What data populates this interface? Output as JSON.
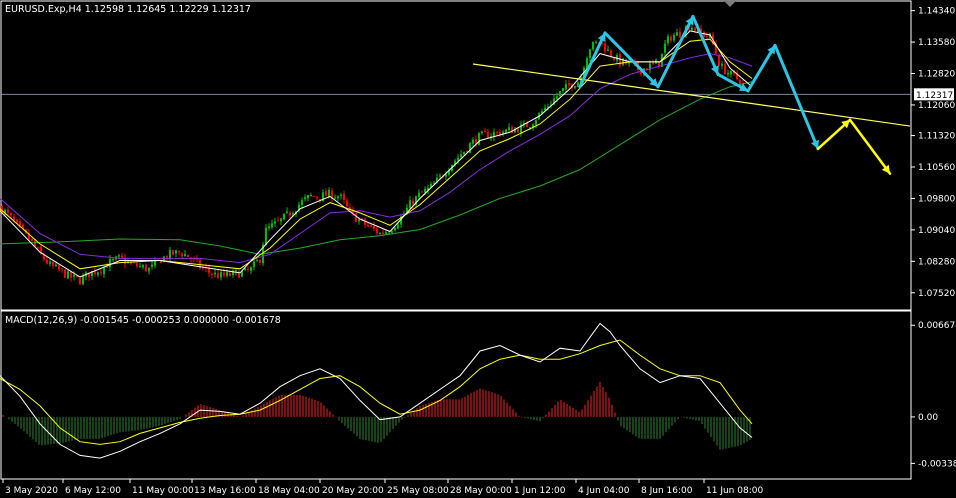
{
  "chart_data": [
    {
      "type": "candlestick",
      "title": "EURUSD.Exp,H4  1.12598 1.12645 1.12229 1.12317",
      "symbol": "EURUSD.Exp,H4",
      "ohlc_header": "1.12598 1.12645 1.12229 1.12317",
      "ylim": [
        1.072,
        1.145
      ],
      "y_ticks": [
        "1.14340",
        "1.13580",
        "1.12820",
        "1.12060",
        "1.11320",
        "1.10560",
        "1.09800",
        "1.09040",
        "1.08280",
        "1.07520"
      ],
      "current_price": "1.12317",
      "x_ticks": [
        "3 May 2020",
        "6 May 12:00",
        "11 May 00:00",
        "13 May 16:00",
        "18 May 04:00",
        "20 May 20:00",
        "25 May 08:00",
        "28 May 00:00",
        "1 Jun 12:00",
        "4 Jun 04:00",
        "8 Jun 16:00",
        "11 Jun 08:00"
      ],
      "price_path": [
        [
          0,
          1.096
        ],
        [
          10,
          1.0935
        ],
        [
          20,
          1.0905
        ],
        [
          30,
          1.088
        ],
        [
          40,
          1.0845
        ],
        [
          50,
          1.0818
        ],
        [
          60,
          1.0805
        ],
        [
          70,
          1.079
        ],
        [
          80,
          1.0782
        ],
        [
          90,
          1.08
        ],
        [
          100,
          1.0808
        ],
        [
          110,
          1.0825
        ],
        [
          120,
          1.0835
        ],
        [
          130,
          1.0822
        ],
        [
          140,
          1.0815
        ],
        [
          150,
          1.0808
        ],
        [
          160,
          1.0832
        ],
        [
          170,
          1.0845
        ],
        [
          180,
          1.085
        ],
        [
          190,
          1.0838
        ],
        [
          200,
          1.0815
        ],
        [
          210,
          1.08
        ],
        [
          220,
          1.0792
        ],
        [
          230,
          1.0795
        ],
        [
          240,
          1.08
        ],
        [
          250,
          1.0805
        ],
        [
          260,
          1.0835
        ],
        [
          265,
          1.09
        ],
        [
          270,
          1.091
        ],
        [
          280,
          1.0925
        ],
        [
          290,
          1.0945
        ],
        [
          300,
          1.0968
        ],
        [
          310,
          1.0985
        ],
        [
          320,
          1.0985
        ],
        [
          330,
          1.099
        ],
        [
          340,
          1.0985
        ],
        [
          350,
          1.0945
        ],
        [
          360,
          1.0925
        ],
        [
          370,
          1.091
        ],
        [
          380,
          1.0895
        ],
        [
          390,
          1.0905
        ],
        [
          400,
          1.093
        ],
        [
          410,
          1.0965
        ],
        [
          420,
          1.099
        ],
        [
          430,
          1.1005
        ],
        [
          440,
          1.103
        ],
        [
          450,
          1.106
        ],
        [
          460,
          1.1085
        ],
        [
          470,
          1.111
        ],
        [
          480,
          1.113
        ],
        [
          490,
          1.1135
        ],
        [
          500,
          1.114
        ],
        [
          510,
          1.1145
        ],
        [
          520,
          1.115
        ],
        [
          530,
          1.116
        ],
        [
          540,
          1.1185
        ],
        [
          550,
          1.121
        ],
        [
          560,
          1.1235
        ],
        [
          570,
          1.1255
        ],
        [
          580,
          1.1265
        ],
        [
          585,
          1.1315
        ],
        [
          590,
          1.1345
        ],
        [
          600,
          1.136
        ],
        [
          610,
          1.133
        ],
        [
          620,
          1.131
        ],
        [
          630,
          1.1305
        ],
        [
          640,
          1.129
        ],
        [
          650,
          1.13
        ],
        [
          660,
          1.131
        ],
        [
          665,
          1.135
        ],
        [
          670,
          1.137
        ],
        [
          680,
          1.138
        ],
        [
          690,
          1.14
        ],
        [
          700,
          1.138
        ],
        [
          710,
          1.137
        ],
        [
          715,
          1.134
        ],
        [
          720,
          1.13
        ],
        [
          730,
          1.128
        ],
        [
          740,
          1.1265
        ],
        [
          745,
          1.1232
        ]
      ],
      "ema_fast": [
        [
          0,
          1.095
        ],
        [
          40,
          1.085
        ],
        [
          80,
          1.079
        ],
        [
          120,
          1.083
        ],
        [
          160,
          1.083
        ],
        [
          200,
          1.0815
        ],
        [
          240,
          1.08
        ],
        [
          270,
          1.088
        ],
        [
          300,
          1.0955
        ],
        [
          330,
          1.0985
        ],
        [
          360,
          1.093
        ],
        [
          390,
          1.09
        ],
        [
          420,
          1.098
        ],
        [
          450,
          1.105
        ],
        [
          480,
          1.112
        ],
        [
          510,
          1.114
        ],
        [
          540,
          1.118
        ],
        [
          570,
          1.1245
        ],
        [
          600,
          1.133
        ],
        [
          630,
          1.131
        ],
        [
          660,
          1.131
        ],
        [
          690,
          1.1385
        ],
        [
          710,
          1.1375
        ],
        [
          730,
          1.1295
        ],
        [
          752,
          1.125
        ]
      ],
      "ema_slow": [
        [
          0,
          1.0955
        ],
        [
          40,
          1.087
        ],
        [
          80,
          1.081
        ],
        [
          120,
          1.0825
        ],
        [
          160,
          1.083
        ],
        [
          200,
          1.082
        ],
        [
          240,
          1.081
        ],
        [
          270,
          1.086
        ],
        [
          300,
          1.093
        ],
        [
          330,
          1.097
        ],
        [
          360,
          1.0945
        ],
        [
          390,
          1.0915
        ],
        [
          420,
          1.0965
        ],
        [
          450,
          1.103
        ],
        [
          480,
          1.1095
        ],
        [
          510,
          1.1125
        ],
        [
          540,
          1.116
        ],
        [
          570,
          1.122
        ],
        [
          600,
          1.13
        ],
        [
          630,
          1.131
        ],
        [
          660,
          1.131
        ],
        [
          690,
          1.136
        ],
        [
          710,
          1.1365
        ],
        [
          730,
          1.131
        ],
        [
          752,
          1.127
        ]
      ],
      "ma_purple": [
        [
          0,
          1.098
        ],
        [
          40,
          1.0895
        ],
        [
          80,
          1.0845
        ],
        [
          120,
          1.0835
        ],
        [
          160,
          1.0835
        ],
        [
          200,
          1.0835
        ],
        [
          240,
          1.0825
        ],
        [
          270,
          1.0845
        ],
        [
          300,
          1.0895
        ],
        [
          330,
          1.0945
        ],
        [
          360,
          1.095
        ],
        [
          390,
          1.0935
        ],
        [
          420,
          1.095
        ],
        [
          450,
          1.0995
        ],
        [
          480,
          1.105
        ],
        [
          510,
          1.1095
        ],
        [
          540,
          1.1135
        ],
        [
          570,
          1.118
        ],
        [
          600,
          1.1245
        ],
        [
          630,
          1.128
        ],
        [
          660,
          1.13
        ],
        [
          690,
          1.132
        ],
        [
          710,
          1.133
        ],
        [
          730,
          1.132
        ],
        [
          752,
          1.13
        ]
      ],
      "ma_green": [
        [
          0,
          1.087
        ],
        [
          60,
          1.0875
        ],
        [
          120,
          1.0882
        ],
        [
          180,
          1.088
        ],
        [
          220,
          1.0865
        ],
        [
          260,
          1.0845
        ],
        [
          300,
          1.086
        ],
        [
          340,
          1.088
        ],
        [
          380,
          1.089
        ],
        [
          420,
          1.0905
        ],
        [
          460,
          1.094
        ],
        [
          500,
          1.098
        ],
        [
          540,
          1.101
        ],
        [
          580,
          1.105
        ],
        [
          620,
          1.111
        ],
        [
          660,
          1.117
        ],
        [
          700,
          1.122
        ],
        [
          730,
          1.125
        ],
        [
          752,
          1.1262
        ]
      ],
      "trendline": [
        [
          473,
          1.1305
        ],
        [
          910,
          1.1155
        ]
      ],
      "forecast_arrows_cyan": [
        [
          580,
          1.125
        ],
        [
          605,
          1.138
        ],
        [
          658,
          1.125
        ],
        [
          693,
          1.142
        ],
        [
          718,
          1.128
        ],
        [
          748,
          1.124
        ],
        [
          775,
          1.135
        ],
        [
          818,
          1.11
        ]
      ],
      "forecast_arrows_yellow": [
        [
          818,
          1.11
        ],
        [
          850,
          1.117
        ],
        [
          890,
          1.104
        ]
      ]
    },
    {
      "type": "histogram",
      "title": "MACD(12,26,9) -0.001545 -0.000253 0.000000 -0.001678",
      "ylim": [
        -0.0043,
        0.0072
      ],
      "y_ticks": [
        "0.006674",
        "0.00",
        "-0.003383"
      ],
      "macd_line": [
        [
          0,
          0.003
        ],
        [
          20,
          0.0015
        ],
        [
          40,
          -0.0005
        ],
        [
          60,
          -0.002
        ],
        [
          80,
          -0.0028
        ],
        [
          100,
          -0.003
        ],
        [
          120,
          -0.0025
        ],
        [
          140,
          -0.0018
        ],
        [
          160,
          -0.0012
        ],
        [
          180,
          -0.0005
        ],
        [
          200,
          0.0005
        ],
        [
          220,
          0.0004
        ],
        [
          240,
          0.0002
        ],
        [
          260,
          0.001
        ],
        [
          280,
          0.0022
        ],
        [
          300,
          0.003
        ],
        [
          320,
          0.0035
        ],
        [
          340,
          0.0028
        ],
        [
          360,
          0.0012
        ],
        [
          380,
          -0.0002
        ],
        [
          400,
          0.0
        ],
        [
          420,
          0.001
        ],
        [
          440,
          0.002
        ],
        [
          460,
          0.003
        ],
        [
          480,
          0.0048
        ],
        [
          500,
          0.0052
        ],
        [
          520,
          0.0045
        ],
        [
          540,
          0.004
        ],
        [
          560,
          0.005
        ],
        [
          580,
          0.0048
        ],
        [
          590,
          0.0058
        ],
        [
          600,
          0.0068
        ],
        [
          610,
          0.0062
        ],
        [
          620,
          0.0052
        ],
        [
          640,
          0.0035
        ],
        [
          660,
          0.0025
        ],
        [
          680,
          0.003
        ],
        [
          700,
          0.0028
        ],
        [
          720,
          0.001
        ],
        [
          740,
          -0.0008
        ],
        [
          752,
          -0.0015
        ]
      ],
      "signal_line": [
        [
          0,
          0.0028
        ],
        [
          20,
          0.002
        ],
        [
          40,
          0.0008
        ],
        [
          60,
          -0.0008
        ],
        [
          80,
          -0.0018
        ],
        [
          100,
          -0.002
        ],
        [
          120,
          -0.0018
        ],
        [
          140,
          -0.0012
        ],
        [
          160,
          -0.0008
        ],
        [
          180,
          -0.0004
        ],
        [
          200,
          -0.0001
        ],
        [
          220,
          0.0001
        ],
        [
          240,
          0.0002
        ],
        [
          260,
          0.0005
        ],
        [
          280,
          0.0012
        ],
        [
          300,
          0.002
        ],
        [
          320,
          0.0028
        ],
        [
          340,
          0.003
        ],
        [
          360,
          0.0022
        ],
        [
          380,
          0.001
        ],
        [
          400,
          0.0002
        ],
        [
          420,
          0.0005
        ],
        [
          440,
          0.0012
        ],
        [
          460,
          0.0022
        ],
        [
          480,
          0.0035
        ],
        [
          500,
          0.0042
        ],
        [
          520,
          0.0045
        ],
        [
          540,
          0.0042
        ],
        [
          560,
          0.0042
        ],
        [
          580,
          0.0046
        ],
        [
          600,
          0.0052
        ],
        [
          620,
          0.0056
        ],
        [
          640,
          0.0045
        ],
        [
          660,
          0.0035
        ],
        [
          680,
          0.003
        ],
        [
          700,
          0.003
        ],
        [
          720,
          0.0025
        ],
        [
          740,
          0.0005
        ],
        [
          752,
          -0.0005
        ]
      ],
      "histogram_hint": "green when MACD below signal, red when above"
    }
  ],
  "colors": {
    "background": "#000000",
    "grid_border": "#ffffff",
    "candle_up": "#00c000",
    "candle_down": "#ff0000",
    "ema_fast": "#ffffff",
    "ema_slow": "#ffff00",
    "ma_purple": "#8a2be2",
    "ma_green": "#22aa22",
    "trendline": "#ffff60",
    "arrow_cyan": "#29c6e6",
    "arrow_yellow": "#ffff00",
    "macd_line": "#ffffff",
    "signal_line": "#ffff00",
    "hist_up": "#ff2020",
    "hist_down": "#2a8a2a"
  }
}
